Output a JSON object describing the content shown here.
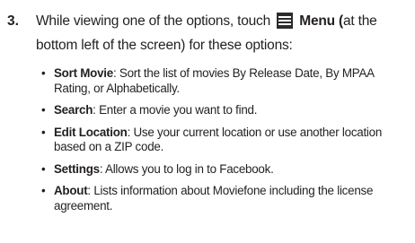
{
  "step": {
    "number": "3.",
    "text_before_icon": "While viewing one of the options, touch",
    "icon": "menu-icon",
    "menu_label": "Menu (",
    "text_after_menu": "at the bottom left of the screen) for these options:"
  },
  "options": [
    {
      "term": "Sort Movie",
      "desc": ": Sort the list of movies By Release Date, By MPAA Rating, or Alphabetically."
    },
    {
      "term": "Search",
      "desc": ": Enter a movie you want to find."
    },
    {
      "term": "Edit Location",
      "desc": ": Use your current location or use another location based on a ZIP code."
    },
    {
      "term": "Settings",
      "desc": ": Allows you to log in to Facebook."
    },
    {
      "term": "About",
      "desc": ": Lists information about Moviefone including the license agreement."
    }
  ],
  "colors": {
    "text": "#231f20",
    "icon": "#2b2b2b"
  }
}
